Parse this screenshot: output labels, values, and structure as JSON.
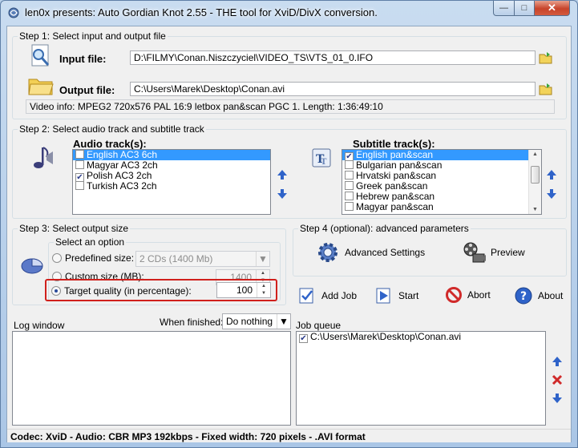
{
  "window": {
    "title": "len0x presents: Auto Gordian Knot 2.55 - THE tool for XviD/DivX conversion."
  },
  "step1": {
    "label": "Step 1: Select input and output file",
    "input_label": "Input file:",
    "input_value": "D:\\FILMY\\Conan.Niszczyciel\\VIDEO_TS\\VTS_01_0.IFO",
    "output_label": "Output file:",
    "output_value": "C:\\Users\\Marek\\Desktop\\Conan.avi",
    "video_info": "Video info: MPEG2 720x576 PAL 16:9 letbox pan&scan PGC 1. Length: 1:36:49:10"
  },
  "step2": {
    "label": "Step 2: Select audio track and subtitle track",
    "audio_label": "Audio track(s):",
    "audio_tracks": [
      {
        "label": "English AC3 6ch",
        "checked": false,
        "selected": true
      },
      {
        "label": "Magyar AC3 2ch",
        "checked": false,
        "selected": false
      },
      {
        "label": "Polish AC3 2ch",
        "checked": true,
        "selected": false
      },
      {
        "label": "Turkish AC3 2ch",
        "checked": false,
        "selected": false
      }
    ],
    "subtitle_label": "Subtitle track(s):",
    "subtitle_tracks": [
      {
        "label": "English pan&scan",
        "checked": true,
        "selected": true
      },
      {
        "label": "Bulgarian pan&scan",
        "checked": false,
        "selected": false
      },
      {
        "label": "Hrvatski pan&scan",
        "checked": false,
        "selected": false
      },
      {
        "label": "Greek pan&scan",
        "checked": false,
        "selected": false
      },
      {
        "label": "Hebrew pan&scan",
        "checked": false,
        "selected": false
      },
      {
        "label": "Magyar pan&scan",
        "checked": false,
        "selected": false
      }
    ]
  },
  "step3": {
    "label": "Step 3: Select output size",
    "option_group": "Select an option",
    "predefined_label": "Predefined size:",
    "predefined_value": "2 CDs (1400 Mb)",
    "custom_label": "Custom size (MB):",
    "custom_value": "1400",
    "quality_label": "Target quality (in percentage):",
    "quality_value": "100"
  },
  "step4": {
    "label": "Step 4 (optional): advanced parameters",
    "advanced_label": "Advanced Settings",
    "preview_label": "Preview"
  },
  "actions": {
    "add_job": "Add Job",
    "start": "Start",
    "abort": "Abort",
    "about": "About"
  },
  "log": {
    "label": "Log window",
    "when_finished_label": "When finished:",
    "when_finished_value": "Do nothing"
  },
  "job_queue": {
    "label": "Job queue",
    "items": [
      {
        "label": "C:\\Users\\Marek\\Desktop\\Conan.avi",
        "checked": true
      }
    ]
  },
  "status": {
    "text": "Codec: XviD -  Audio: CBR MP3 192kbps -  Fixed width: 720 pixels - .AVI format"
  },
  "colors": {
    "accent_blue": "#3399ff",
    "highlight_red": "#d0201c",
    "arrow_blue": "#2f63c9",
    "delete_red": "#d02a2a"
  }
}
